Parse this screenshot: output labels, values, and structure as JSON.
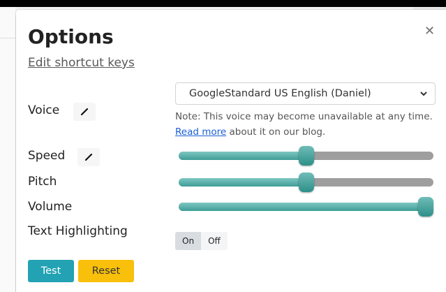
{
  "dialog": {
    "title": "Options",
    "shortcut_link": "Edit shortcut keys"
  },
  "voice": {
    "label": "Voice",
    "selected": "GoogleStandard US English (Daniel)",
    "note_pre": "Note: This voice may become unavailable at any time. ",
    "note_link": "Read more",
    "note_post": " about it on our blog."
  },
  "speed": {
    "label": "Speed",
    "value_fraction": 0.5
  },
  "pitch": {
    "label": "Pitch",
    "value_fraction": 0.5
  },
  "volume": {
    "label": "Volume",
    "value_fraction": 1.0
  },
  "highlighting": {
    "label": "Text Highlighting",
    "on_label": "On",
    "off_label": "Off",
    "selected": "On"
  },
  "buttons": {
    "test_label": "Test",
    "reset_label": "Reset"
  },
  "colors": {
    "slider_fill": "#3f9c96",
    "slider_track": "#9e9e9e",
    "test_button": "#22a2b3",
    "reset_button": "#f8c00a",
    "link": "#1a5fd6"
  },
  "icons": {
    "close": "close-icon",
    "edit": "pencil-icon",
    "dropdown": "chevron-down-icon"
  }
}
